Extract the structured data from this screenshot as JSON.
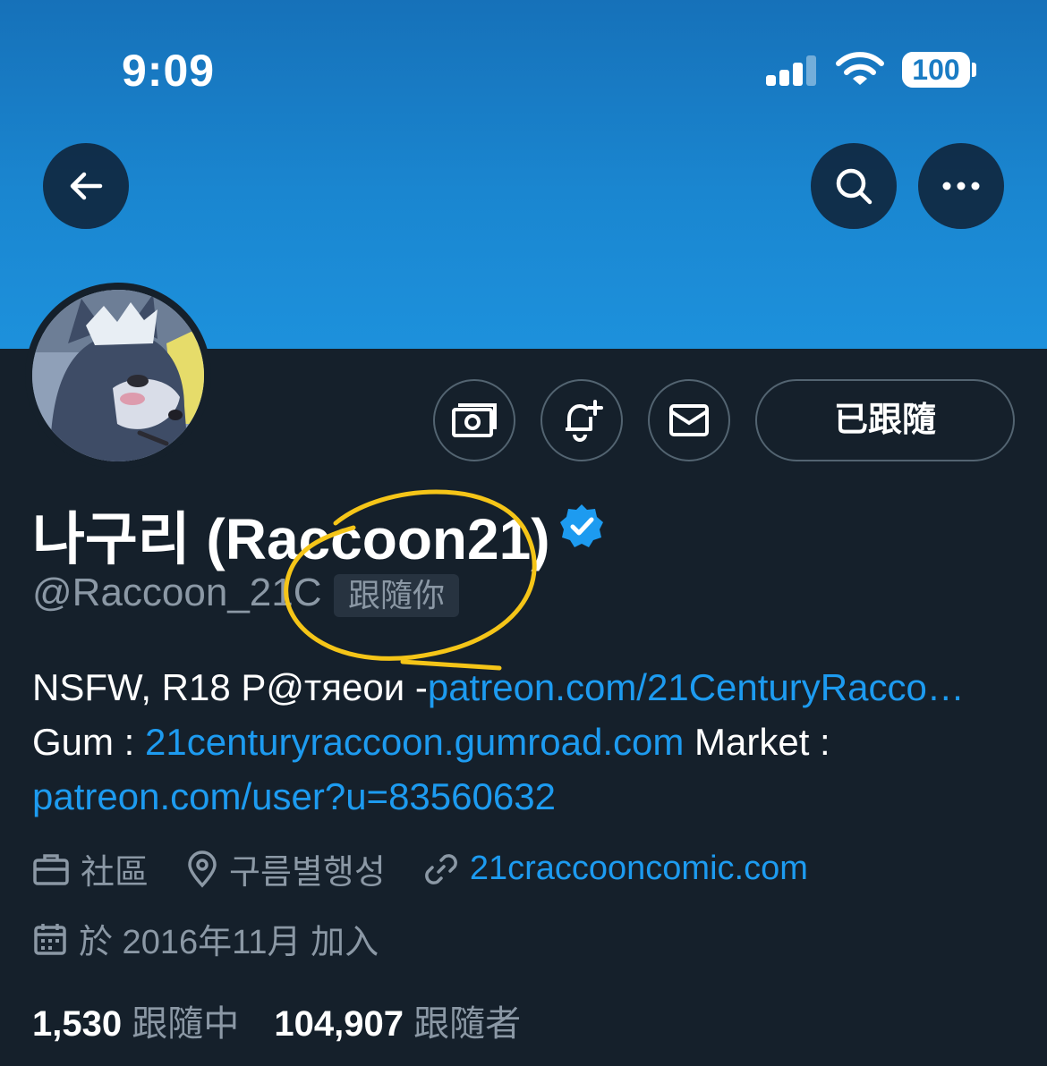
{
  "status_bar": {
    "time": "9:09",
    "battery": "100"
  },
  "profile": {
    "display_name": "나구리 (Raccoon21)",
    "handle": "@Raccoon_21C",
    "follows_you": "跟隨你",
    "follow_state": "已跟隨",
    "bio": {
      "line1_text": "NSFW, R18 P@тяеои -",
      "line1_link": "patreon.com/21CenturyRacco…",
      "line2_text": "Gum : ",
      "line2_link": "21centuryraccoon.gumroad.com",
      "line2_suffix": " Market :",
      "line3_link": "patreon.com/user?u=83560632"
    },
    "category": "社區",
    "location": "구름별행성",
    "website": "21craccooncomic.com",
    "joined": "於 2016年11月 加入",
    "following_count": "1,530",
    "following_label": "跟隨中",
    "followers_count": "104,907",
    "followers_label": "跟隨者"
  },
  "colors": {
    "accent": "#1d9bf0",
    "background": "#15202b",
    "annotation": "#f5c518"
  }
}
